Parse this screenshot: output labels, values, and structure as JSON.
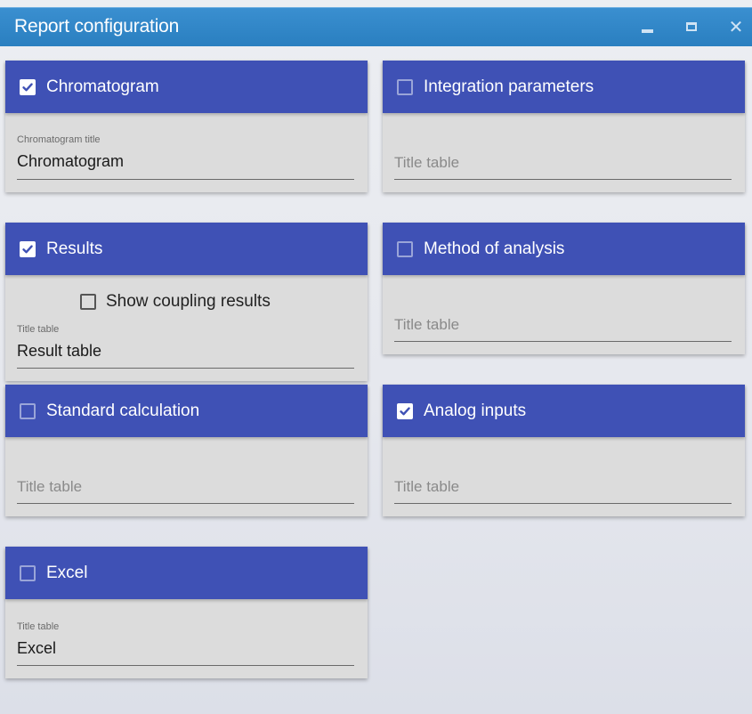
{
  "window": {
    "title": "Report configuration",
    "minimize_icon": "minimize-icon",
    "maximize_icon": "maximize-icon",
    "close_icon": "close-icon",
    "accent_color": "#2a7fc0"
  },
  "header_color": "#3f51b5",
  "cards": {
    "chromatogram": {
      "label": "Chromatogram",
      "checked": true,
      "field_label": "Chromatogram title",
      "field_value": "Chromatogram"
    },
    "integration": {
      "label": "Integration parameters",
      "checked": false,
      "placeholder": "Title table"
    },
    "results": {
      "label": "Results",
      "checked": true,
      "coupling_label": "Show coupling results",
      "coupling_checked": false,
      "field_label": "Title table",
      "field_value": "Result table"
    },
    "method": {
      "label": "Method of analysis",
      "checked": false,
      "placeholder": "Title table"
    },
    "standard": {
      "label": "Standard calculation",
      "checked": false,
      "placeholder": "Title table"
    },
    "analog": {
      "label": "Analog inputs",
      "checked": true,
      "placeholder": "Title table"
    },
    "excel": {
      "label": "Excel",
      "checked": false,
      "field_label": "Title table",
      "field_value": "Excel"
    }
  }
}
